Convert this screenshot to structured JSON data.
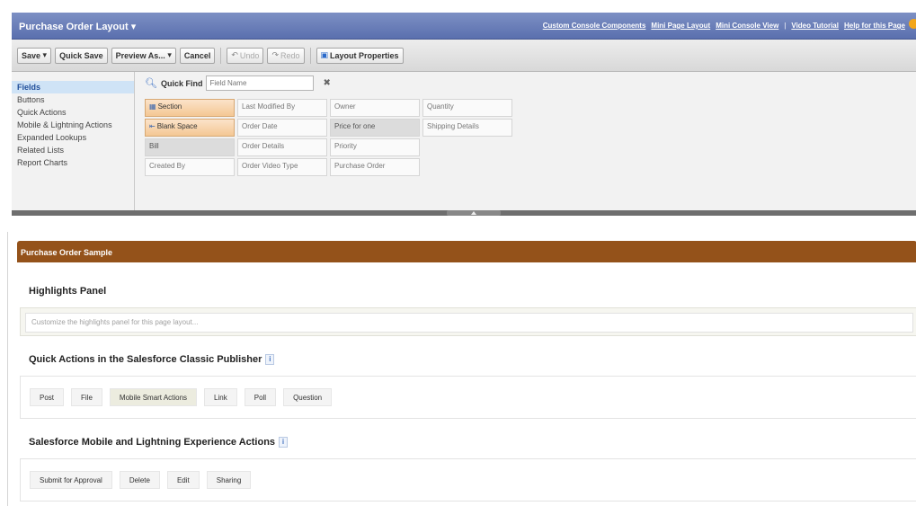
{
  "header": {
    "title": "Purchase Order Layout",
    "links": [
      "Custom Console Components",
      "Mini Page Layout",
      "Mini Console View",
      "Video Tutorial",
      "Help for this Page"
    ]
  },
  "toolbar": {
    "save": "Save",
    "quick_save": "Quick Save",
    "preview_as": "Preview As...",
    "cancel": "Cancel",
    "undo": "Undo",
    "redo": "Redo",
    "layout_properties": "Layout Properties"
  },
  "palette": {
    "categories": [
      "Fields",
      "Buttons",
      "Quick Actions",
      "Mobile & Lightning Actions",
      "Expanded Lookups",
      "Related Lists",
      "Report Charts"
    ],
    "quick_find_label": "Quick Find",
    "quick_find_placeholder": "Field Name",
    "fields": [
      [
        "Section",
        "Last Modified By",
        "Owner",
        "Quantity"
      ],
      [
        "Blank Space",
        "Order Date",
        "Price for one",
        "Shipping Details"
      ],
      [
        "Bill",
        "Order Details",
        "Priority",
        ""
      ],
      [
        "Created By",
        "Order Video Type",
        "Purchase Order",
        ""
      ]
    ]
  },
  "layout": {
    "sample_title": "Purchase Order Sample",
    "highlights_title": "Highlights Panel",
    "highlights_placeholder": "Customize the highlights panel for this page layout...",
    "classic_title": "Quick Actions in the Salesforce Classic Publisher",
    "classic_actions": [
      "Post",
      "File",
      "Mobile Smart Actions",
      "Link",
      "Poll",
      "Question"
    ],
    "lightning_title": "Salesforce Mobile and Lightning Experience Actions",
    "lightning_actions": [
      "Submit for Approval",
      "Delete",
      "Edit",
      "Sharing"
    ]
  },
  "colors": {
    "header_blue": "#5a6fae",
    "sample_brown": "#94521a",
    "selected_category": "#cfe3f6"
  }
}
